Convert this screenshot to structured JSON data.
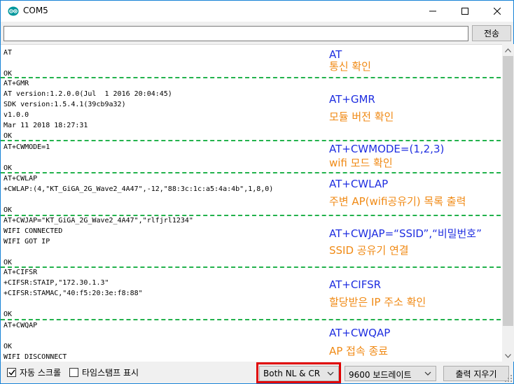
{
  "window": {
    "title": "COM5"
  },
  "toolbar": {
    "input_value": "",
    "send_label": "전송"
  },
  "serial_blocks": [
    {
      "lines": "AT\n\nOK",
      "note_cmd": "AT",
      "note_desc": "통신 확인"
    },
    {
      "lines": "AT+GMR\nAT version:1.2.0.0(Jul  1 2016 20:04:45)\nSDK version:1.5.4.1(39cb9a32)\nv1.0.0\nMar 11 2018 18:27:31\nOK",
      "note_cmd": "AT+GMR",
      "note_desc": "모듈 버전 확인"
    },
    {
      "lines": "AT+CWMODE=1\n\nOK",
      "note_cmd": "AT+CWMODE=(1,2,3)",
      "note_desc": "wifi 모드 확인"
    },
    {
      "lines": "AT+CWLAP\n+CWLAP:(4,\"KT_GiGA_2G_Wave2_4A47\",-12,\"88:3c:1c:a5:4a:4b\",1,8,0)\n\nOK",
      "note_cmd": "AT+CWLAP",
      "note_desc": "주변 AP(wifi공유기) 목록 출력"
    },
    {
      "lines": "AT+CWJAP=\"KT_GiGA_2G_Wave2_4A47\",\"rlfjrl1234\"\nWIFI CONNECTED\nWIFI GOT IP\n\nOK",
      "note_cmd": "AT+CWJAP=“SSID”,“비밀번호”",
      "note_desc": "SSID 공유기 연결"
    },
    {
      "lines": "AT+CIFSR\n+CIFSR:STAIP,\"172.30.1.3\"\n+CIFSR:STAMAC,\"40:f5:20:3e:f8:88\"\n\nOK",
      "note_cmd": "AT+CIFSR",
      "note_desc": "할당받은 IP 주소 확인"
    },
    {
      "lines": "AT+CWQAP\n\nOK\nWIFI DISCONNECT",
      "note_cmd": "AT+CWQAP",
      "note_desc": "AP 접속 종료"
    }
  ],
  "status": {
    "autoscroll_label": "자동 스크롤",
    "autoscroll_checked": true,
    "timestamp_label": "타임스탬프 표시",
    "timestamp_checked": false,
    "line_ending": "Both NL & CR",
    "baud_rate": "9600 보드레이트",
    "clear_label": "출력 지우기"
  },
  "colors": {
    "separator": "#22b24c",
    "note_command": "#1f2ee0",
    "note_description": "#f08a15",
    "highlight_box": "#e00000",
    "window_border": "#1883d7"
  }
}
